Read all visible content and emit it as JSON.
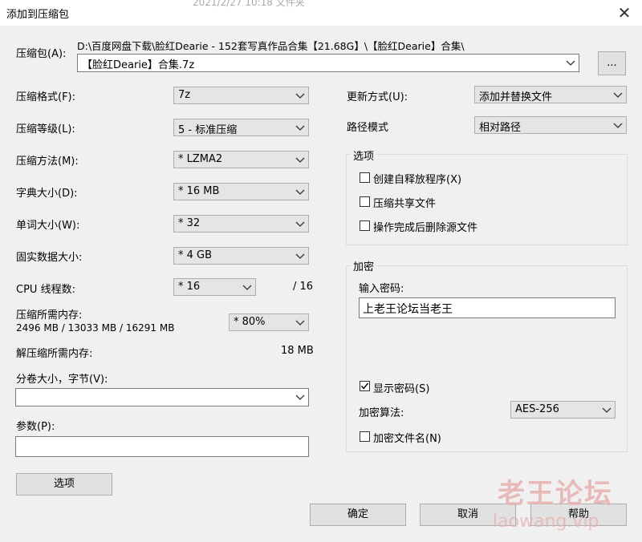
{
  "window": {
    "title": "添加到压缩包",
    "bg_text": "2021/2/27 10:18      文件夹"
  },
  "archive": {
    "label": "压缩包(A):",
    "path": "D:\\百度网盘下载\\脸红Dearie - 152套写真作品合集【21.68G】\\【脸红Dearie】合集\\",
    "name": "【脸红Dearie】合集.7z",
    "browse_label": "..."
  },
  "left": {
    "format": {
      "label": "压缩格式(F):",
      "value": "7z"
    },
    "level": {
      "label": "压缩等级(L):",
      "value": "5 - 标准压缩"
    },
    "method": {
      "label": "压缩方法(M):",
      "value": "* LZMA2"
    },
    "dict": {
      "label": "字典大小(D):",
      "value": "* 16 MB"
    },
    "word": {
      "label": "单词大小(W):",
      "value": "* 32"
    },
    "solid": {
      "label": "固实数据大小:",
      "value": "* 4 GB"
    },
    "threads": {
      "label": "CPU 线程数:",
      "value": "* 16",
      "max": "/ 16"
    },
    "memory": {
      "label": "压缩所需内存:",
      "detail": "2496 MB / 13033 MB / 16291 MB",
      "value": "* 80%"
    },
    "decomp": {
      "label": "解压缩所需内存:",
      "value": "18 MB"
    },
    "volume": {
      "label": "分卷大小，字节(V):",
      "value": ""
    },
    "params": {
      "label": "参数(P):",
      "value": ""
    },
    "options_button": "选项"
  },
  "right": {
    "update": {
      "label": "更新方式(U):",
      "value": "添加并替换文件"
    },
    "path_mode": {
      "label": "路径模式",
      "value": "相对路径"
    },
    "options_group": {
      "title": "选项",
      "items": [
        {
          "label": "创建自释放程序(X)",
          "checked": false
        },
        {
          "label": "压缩共享文件",
          "checked": false
        },
        {
          "label": "操作完成后删除源文件",
          "checked": false
        }
      ]
    },
    "encryption": {
      "title": "加密",
      "password_label": "输入密码:",
      "password": "上老王论坛当老王",
      "show_password": {
        "label": "显示密码(S)",
        "checked": true
      },
      "method_label": "加密算法:",
      "method_value": "AES-256",
      "encrypt_names": {
        "label": "加密文件名(N)",
        "checked": false
      }
    }
  },
  "buttons": {
    "ok": "确定",
    "cancel": "取消",
    "help": "帮助"
  },
  "watermark": {
    "line1": "老王论坛",
    "line2": "laowang.vip"
  }
}
